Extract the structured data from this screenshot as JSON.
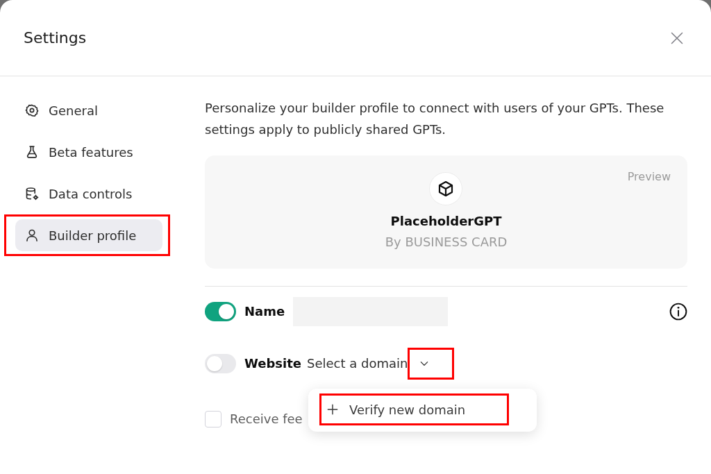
{
  "dialog": {
    "title": "Settings"
  },
  "sidebar": {
    "items": [
      {
        "label": "General",
        "selected": false,
        "highlighted": false
      },
      {
        "label": "Beta features",
        "selected": false,
        "highlighted": false
      },
      {
        "label": "Data controls",
        "selected": false,
        "highlighted": false
      },
      {
        "label": "Builder profile",
        "selected": true,
        "highlighted": true
      }
    ]
  },
  "builder_profile": {
    "description": "Personalize your builder profile to connect with users of your GPTs. These settings apply to publicly shared GPTs.",
    "preview": {
      "label": "Preview",
      "name": "PlaceholderGPT",
      "byline": "By BUSINESS CARD"
    },
    "fields": [
      {
        "kind": "text",
        "label": "Name",
        "on": true,
        "info_icon": true
      },
      {
        "kind": "domain",
        "label": "Website",
        "on": false,
        "value": "Select a domain",
        "expanded": true,
        "highlighted": true,
        "menu": [
          {
            "label": "Verify new domain",
            "highlighted": true
          }
        ]
      },
      {
        "kind": "checkbox",
        "label": "Receive fee",
        "checked": false
      }
    ]
  }
}
